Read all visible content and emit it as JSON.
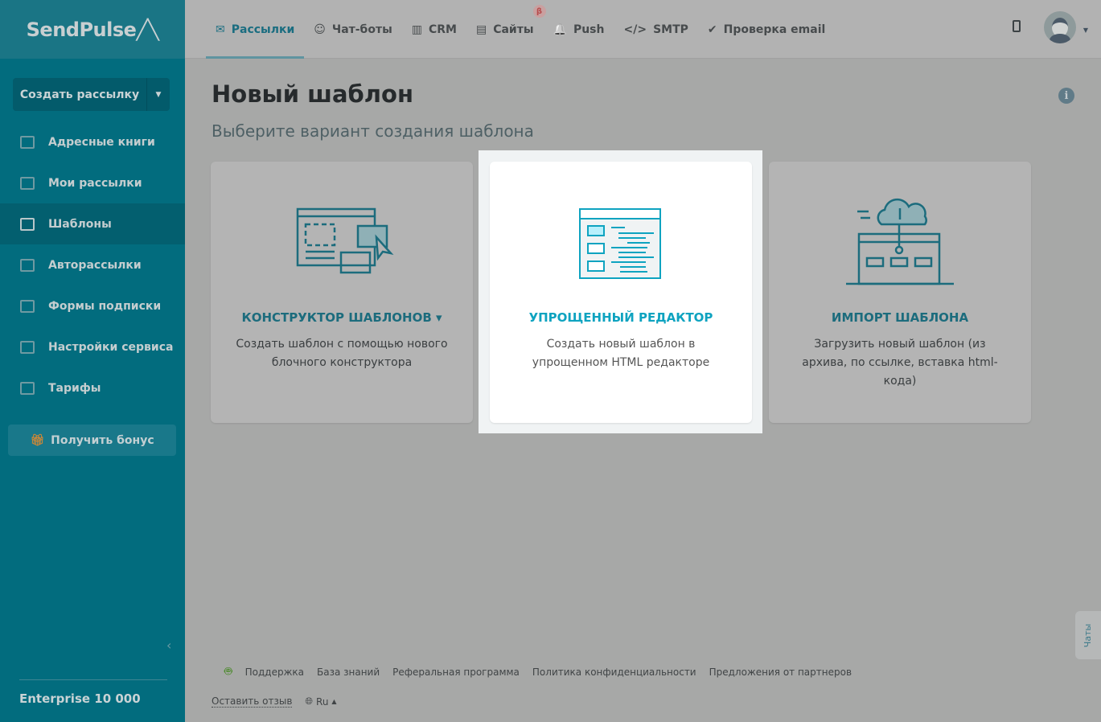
{
  "logo": "SendPulse",
  "sidebar": {
    "create_button": "Создать рассылку",
    "items": [
      {
        "label": "Адресные книги",
        "icon": "address-book-icon"
      },
      {
        "label": "Мои рассылки",
        "icon": "outbox-icon"
      },
      {
        "label": "Шаблоны",
        "icon": "templates-icon",
        "active": true
      },
      {
        "label": "Авторассылки",
        "icon": "automation-icon"
      },
      {
        "label": "Формы подписки",
        "icon": "form-icon"
      },
      {
        "label": "Настройки сервиса",
        "icon": "settings-icon"
      },
      {
        "label": "Тарифы",
        "icon": "wallet-icon"
      }
    ],
    "bonus": "Получить бонус",
    "plan": "Enterprise 10 000"
  },
  "topnav": {
    "tabs": [
      {
        "label": "Рассылки",
        "icon": "✉"
      },
      {
        "label": "Чат-боты",
        "icon": "☺"
      },
      {
        "label": "CRM",
        "icon": "▥"
      },
      {
        "label": "Сайты",
        "icon": "▤"
      },
      {
        "label": "Push",
        "icon": "🔔"
      },
      {
        "label": "SMTP",
        "icon": "</>"
      },
      {
        "label": "Проверка email",
        "icon": "✔"
      }
    ],
    "beta": "β"
  },
  "page": {
    "title": "Новый шаблон",
    "subtitle": "Выберите вариант создания шаблона",
    "cards": [
      {
        "title": "КОНСТРУКТОР ШАБЛОНОВ ▾",
        "desc": "Создать шаблон с помощью нового блочного конструктора"
      },
      {
        "title": "УПРОЩЕННЫЙ РЕДАКТОР",
        "desc": "Создать новый шаблон в упрощенном HTML редакторе"
      },
      {
        "title": "ИМПОРТ ШАБЛОНА",
        "desc": "Загрузить новый шаблон (из архива, по ссылке, вставка html-кода)"
      }
    ]
  },
  "footer": {
    "links": [
      "Поддержка",
      "База знаний",
      "Реферальная программа",
      "Политика конфиденциальности",
      "Предложения от партнеров"
    ],
    "feedback": "Оставить отзыв",
    "lang": "Ru"
  },
  "chats": "Чаты",
  "colors": {
    "accent": "#0ea3c0",
    "sidebar": "#026c7e"
  }
}
